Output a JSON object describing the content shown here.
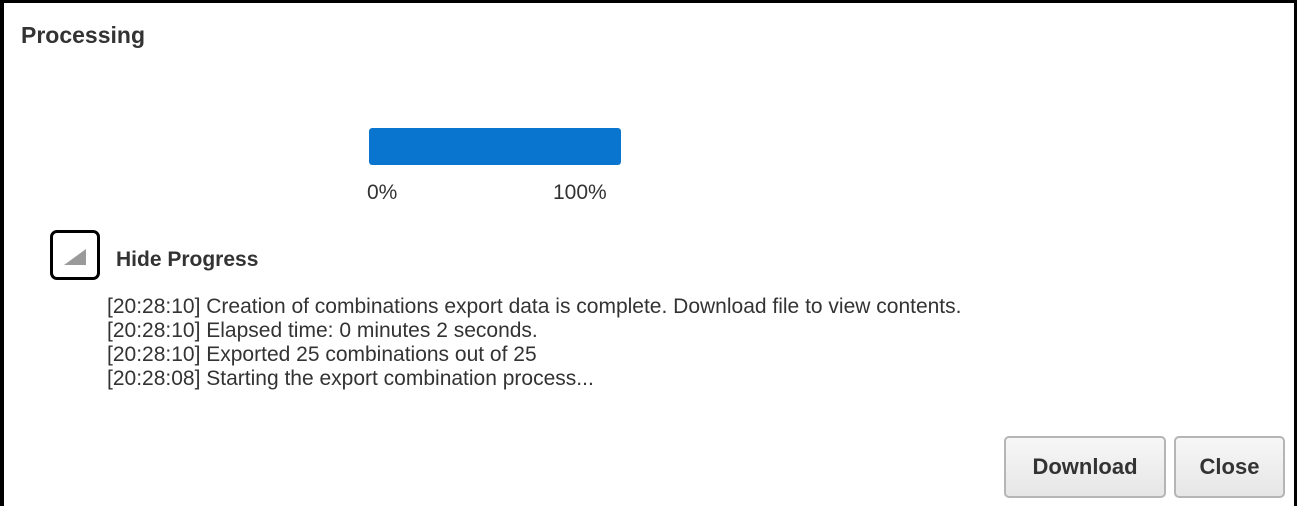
{
  "dialog": {
    "title": "Processing"
  },
  "progress": {
    "value_percent": 100,
    "min_label": "0%",
    "max_label": "100%",
    "fill_color": "#0a75cf"
  },
  "details_toggle": {
    "icon": "triangle-collapse-icon",
    "label": "Hide Progress"
  },
  "log": {
    "entries": [
      "[20:28:10] Creation of combinations export data is complete. Download file to view contents.",
      "[20:28:10] Elapsed time: 0 minutes 2 seconds.",
      "[20:28:10] Exported 25 combinations out of 25",
      "[20:28:08] Starting the export combination process..."
    ]
  },
  "actions": {
    "download_label": "Download",
    "close_label": "Close"
  }
}
